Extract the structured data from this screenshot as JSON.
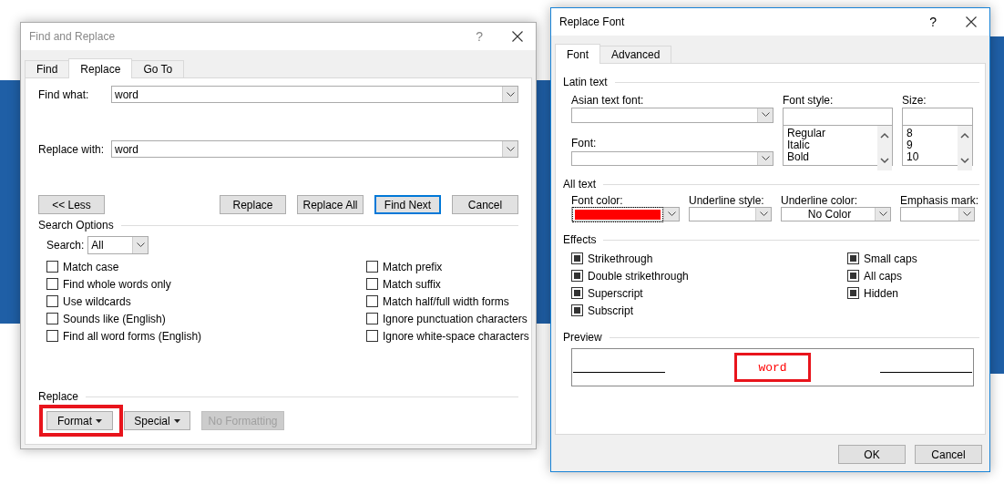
{
  "find_dialog": {
    "title": "Find and Replace",
    "help": "?",
    "tabs": [
      {
        "label": "Find",
        "selected": false
      },
      {
        "label": "Replace",
        "selected": true
      },
      {
        "label": "Go To",
        "selected": false
      }
    ],
    "find_what": {
      "label": "Find what:",
      "value": "word"
    },
    "replace_with": {
      "label": "Replace with:",
      "value": "word"
    },
    "less_button": "<< Less",
    "buttons": [
      {
        "label": "Replace",
        "default": false
      },
      {
        "label": "Replace All",
        "default": false
      },
      {
        "label": "Find Next",
        "default": true
      },
      {
        "label": "Cancel",
        "default": false
      }
    ],
    "search_options": {
      "title": "Search Options",
      "search_label": "Search:",
      "search_value": "All",
      "left_options": [
        {
          "label": "Match case",
          "checked": false
        },
        {
          "label": "Find whole words only",
          "checked": false
        },
        {
          "label": "Use wildcards",
          "checked": false
        },
        {
          "label": "Sounds like (English)",
          "checked": false
        },
        {
          "label": "Find all word forms (English)",
          "checked": false
        }
      ],
      "right_options": [
        {
          "label": "Match prefix",
          "checked": false
        },
        {
          "label": "Match suffix",
          "checked": false
        },
        {
          "label": "Match half/full width forms",
          "checked": false
        },
        {
          "label": "Ignore punctuation characters",
          "checked": false
        },
        {
          "label": "Ignore white-space characters",
          "checked": false
        }
      ]
    },
    "replace_group": {
      "title": "Replace",
      "buttons": [
        {
          "label": "Format",
          "dropdown": true,
          "disabled": false,
          "highlighted": true
        },
        {
          "label": "Special",
          "dropdown": true,
          "disabled": false,
          "highlighted": false
        },
        {
          "label": "No Formatting",
          "dropdown": false,
          "disabled": true,
          "highlighted": false
        }
      ]
    }
  },
  "font_dialog": {
    "title": "Replace Font",
    "help": "?",
    "tabs": [
      {
        "label": "Font",
        "selected": true
      },
      {
        "label": "Advanced",
        "selected": false
      }
    ],
    "latin_text": {
      "title": "Latin text",
      "asian_font": {
        "label": "Asian text font:"
      },
      "font": {
        "label": "Font:"
      },
      "font_style": {
        "label": "Font style:",
        "items": [
          "Regular",
          "Italic",
          "Bold"
        ]
      },
      "size": {
        "label": "Size:",
        "items": [
          "8",
          "9",
          "10"
        ]
      }
    },
    "all_text": {
      "title": "All text",
      "font_color": {
        "label": "Font color:",
        "color": "#ff0000"
      },
      "underline_style": {
        "label": "Underline style:"
      },
      "underline_color": {
        "label": "Underline color:",
        "value": "No Color"
      },
      "emphasis_mark": {
        "label": "Emphasis mark:"
      }
    },
    "effects": {
      "title": "Effects",
      "left": [
        {
          "label": "Strikethrough",
          "indeterminate": true
        },
        {
          "label": "Double strikethrough",
          "indeterminate": true
        },
        {
          "label": "Superscript",
          "indeterminate": true
        },
        {
          "label": "Subscript",
          "indeterminate": true
        }
      ],
      "right": [
        {
          "label": "Small caps",
          "indeterminate": true
        },
        {
          "label": "All caps",
          "indeterminate": true
        },
        {
          "label": "Hidden",
          "indeterminate": true
        }
      ]
    },
    "preview": {
      "title": "Preview",
      "text": "word",
      "highlighted": true
    },
    "buttons": [
      "OK",
      "Cancel"
    ]
  }
}
